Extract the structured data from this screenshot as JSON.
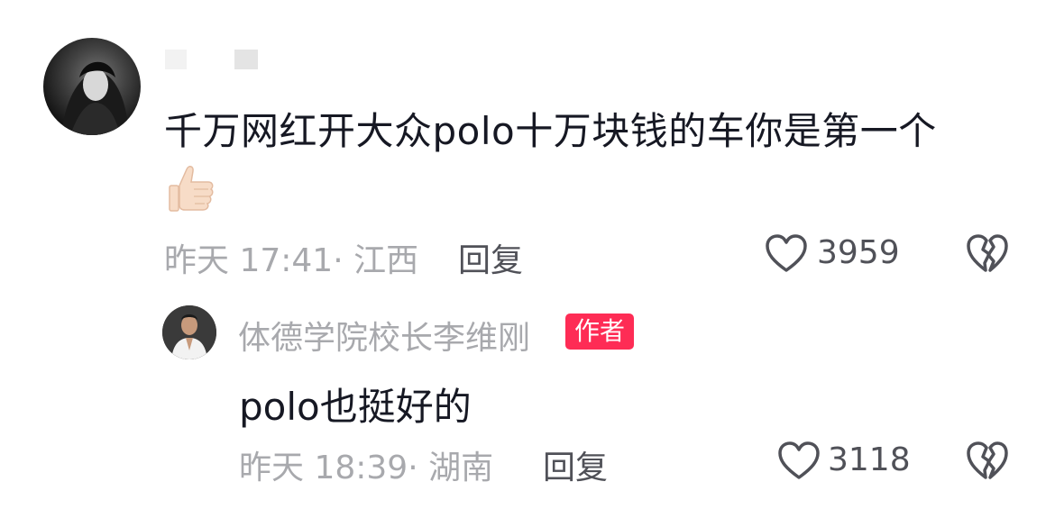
{
  "comment": {
    "text": "千万网红开大众polo十万块钱的车你是第一个",
    "emoji": "thumbs-up-light",
    "meta": "昨天 17:41· 江西",
    "reply_label": "回复",
    "like_count": "3959"
  },
  "reply": {
    "username": "体德学院校长李维刚",
    "badge": "作者",
    "text": "polo也挺好的",
    "meta": "昨天 18:39· 湖南",
    "reply_label": "回复",
    "like_count": "3118"
  },
  "colors": {
    "text_primary": "#161823",
    "text_secondary": "#a8a9ad",
    "action": "#505158",
    "badge_bg": "#fe2c55"
  },
  "icons": {
    "like": "heart-outline-icon",
    "dislike": "broken-heart-icon"
  }
}
